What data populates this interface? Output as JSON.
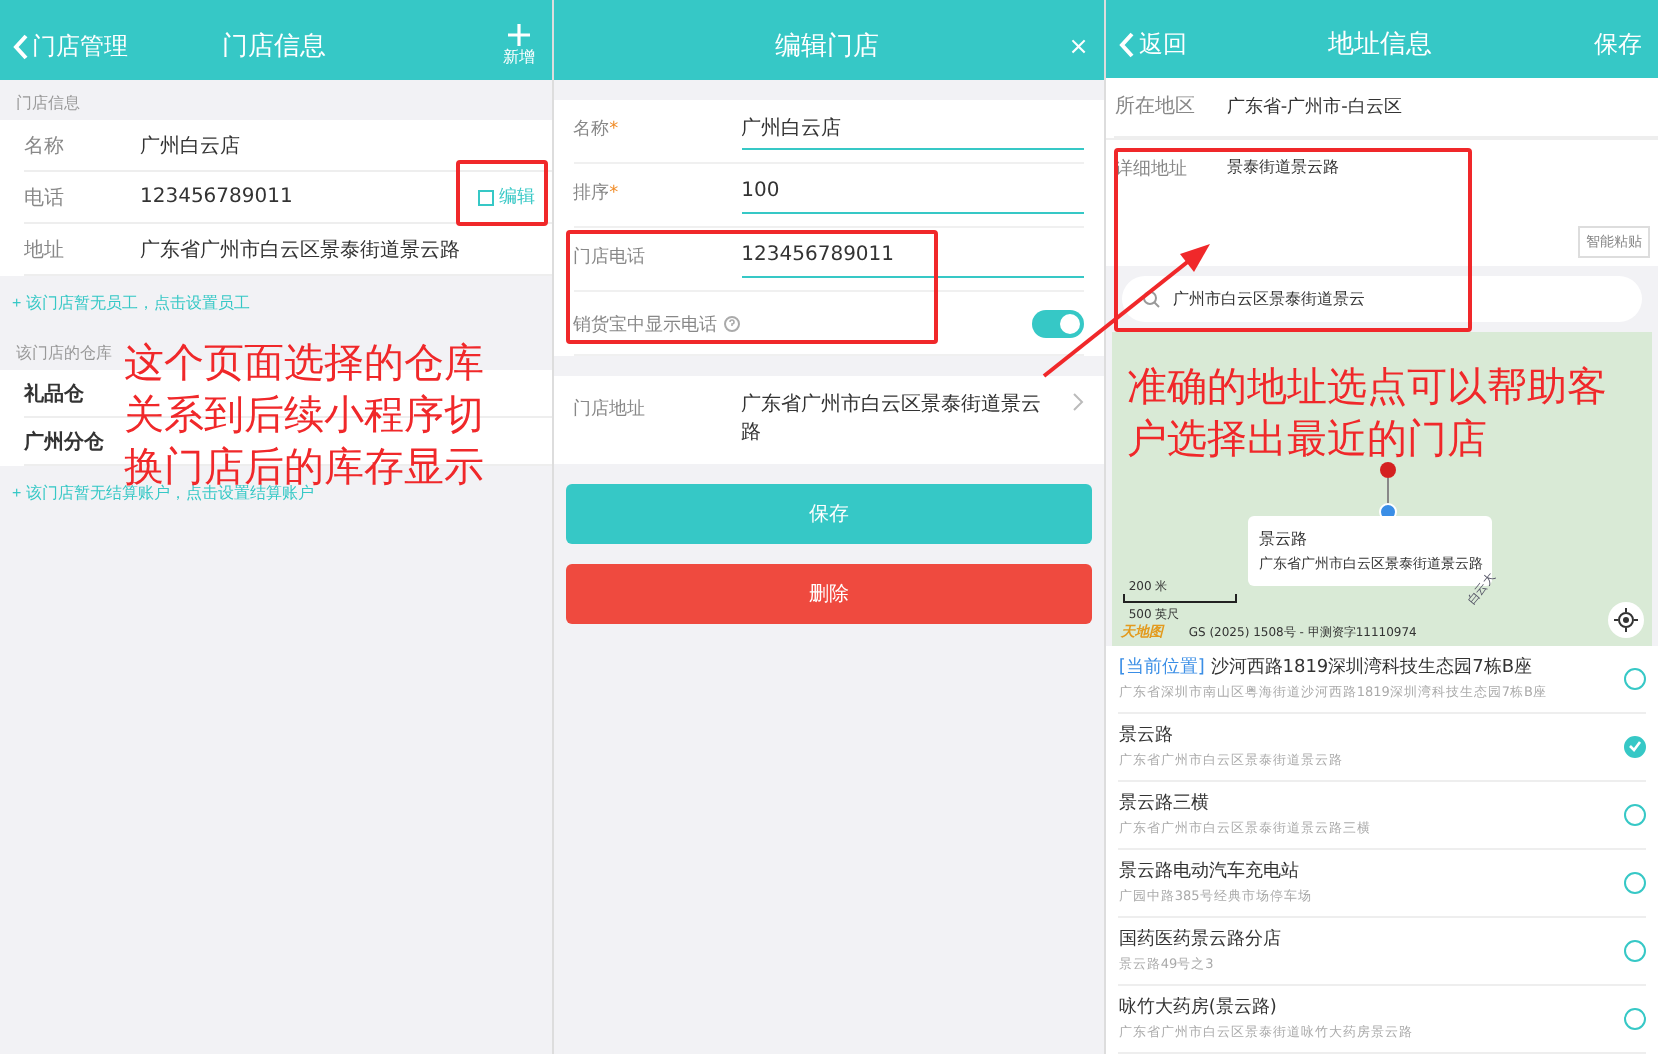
{
  "screens": [
    {
      "header": {
        "back": "门店管理",
        "title": "门店信息",
        "action": "新增"
      },
      "info": {
        "section": "门店信息",
        "rows": [
          {
            "label": "名称",
            "value": "广州白云店"
          },
          {
            "label": "电话",
            "value": "123456789011",
            "edit": "编辑"
          },
          {
            "label": "地址",
            "value": "广东省广州市白云区景泰街道景云路"
          }
        ]
      },
      "staff_hint": "+ 该门店暂无员工，点击设置员工",
      "warehouse": {
        "section": "该门店的仓库",
        "items": [
          "礼品仓",
          "广州分仓"
        ]
      },
      "account_hint": "+ 该门店暂无结算账户，点击设置结算账户",
      "note": "这个页面选择的仓库关系到后续小程序切换门店后的库存显示"
    },
    {
      "header": {
        "title": "编辑门店",
        "close": "×"
      },
      "fields": [
        {
          "kind": "input",
          "label": "名称",
          "mark": "*",
          "value": "广州白云店"
        },
        {
          "kind": "input",
          "label": "排序",
          "mark": "*",
          "value": "100"
        },
        {
          "kind": "input",
          "label": "门店电话",
          "value": "123456789011"
        },
        {
          "kind": "toggle",
          "label": "销货宝中显示电话",
          "on": true
        }
      ],
      "address": {
        "label": "门店地址",
        "value": "广东省广州市白云区景泰街道景云路"
      },
      "buttons": [
        {
          "kind": "primary",
          "label": "保存"
        },
        {
          "kind": "danger",
          "label": "删除"
        }
      ]
    },
    {
      "header": {
        "back": "返回",
        "title": "地址信息",
        "action": "保存"
      },
      "region": {
        "label": "所在地区",
        "value": "广东省-广州市-白云区"
      },
      "detail": {
        "label": "详细地址",
        "value": "景泰街道景云路",
        "paste": "智能粘贴"
      },
      "search": {
        "value": "广州市白云区景泰街道景云"
      },
      "map": {
        "callout_title": "景云路",
        "callout_address": "广东省广州市白云区景泰街道景云路",
        "road": "白云大",
        "scale_metric": "200 米",
        "scale_imperial": "500 英尺",
        "logo": "天地图",
        "copyright": "GS (2025) 1508号 - 甲测资字11110974"
      },
      "note": "准确的地址选点可以帮助客户选择出最近的门店",
      "places": [
        {
          "tag": "[当前位置]",
          "name": "沙河西路1819深圳湾科技生态园7栋B座",
          "address": "广东省深圳市南山区粤海街道沙河西路1819深圳湾科技生态园7栋B座",
          "selected": false
        },
        {
          "name": "景云路",
          "address": "广东省广州市白云区景泰街道景云路",
          "selected": true
        },
        {
          "name": "景云路三横",
          "address": "广东省广州市白云区景泰街道景云路三横",
          "selected": false
        },
        {
          "name": "景云路电动汽车充电站",
          "address": "广园中路385号经典市场停车场",
          "selected": false
        },
        {
          "name": "国药医药景云路分店",
          "address": "景云路49号之3",
          "selected": false
        },
        {
          "name": "咏竹大药房(景云路)",
          "address": "广东省广州市白云区景泰街道咏竹大药房景云路",
          "selected": false
        }
      ]
    }
  ]
}
